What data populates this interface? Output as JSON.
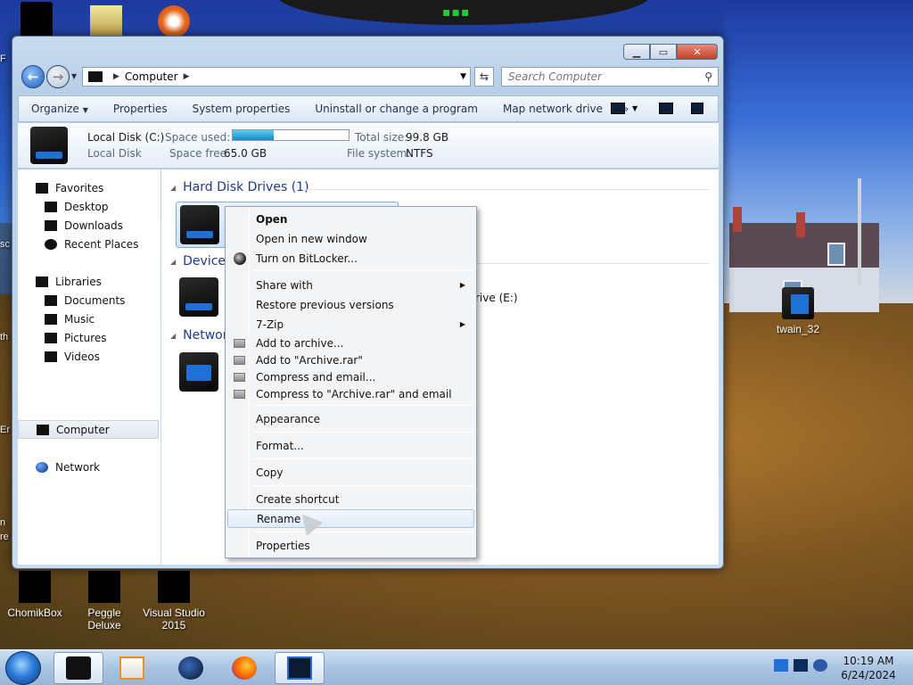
{
  "window": {
    "address": {
      "crumb": "Computer"
    },
    "search": {
      "placeholder": "Search Computer"
    },
    "toolbar": {
      "organize": "Organize",
      "properties": "Properties",
      "system_properties": "System properties",
      "uninstall": "Uninstall or change a program",
      "map_drive": "Map network drive",
      "more": "»"
    },
    "details": {
      "name": "Local Disk (C:)",
      "type": "Local Disk",
      "space_used_label": "Space used:",
      "space_used_fraction": 0.35,
      "space_free_label": "Space free:",
      "space_free_value": "65.0 GB",
      "total_size_label": "Total size:",
      "total_size_value": "99.8 GB",
      "file_system_label": "File system:",
      "file_system_value": "NTFS"
    },
    "nav": {
      "favorites": "Favorites",
      "desktop": "Desktop",
      "downloads": "Downloads",
      "recent": "Recent Places",
      "libraries": "Libraries",
      "documents": "Documents",
      "music": "Music",
      "pictures": "Pictures",
      "videos": "Videos",
      "computer": "Computer",
      "network": "Network"
    },
    "content": {
      "hard_disks": "Hard Disk Drives (1)",
      "devices": "Devices",
      "network": "Networ",
      "drive_e_partial": "rive (E:)"
    }
  },
  "context_menu": {
    "open": "Open",
    "open_new": "Open in new window",
    "bitlocker": "Turn on BitLocker...",
    "share_with": "Share with",
    "restore": "Restore previous versions",
    "zip": "7-Zip",
    "add_archive": "Add to archive...",
    "add_rar": "Add to \"Archive.rar\"",
    "compress_email": "Compress and email...",
    "compress_rar_email": "Compress to \"Archive.rar\" and email",
    "appearance": "Appearance",
    "format": "Format...",
    "copy": "Copy",
    "create_shortcut": "Create shortcut",
    "rename": "Rename",
    "properties": "Properties"
  },
  "desktop": {
    "icons": {
      "chomikbox": "ChomikBox",
      "peggle": "Peggle Deluxe",
      "vs": "Visual Studio 2015",
      "twain": "twain_32"
    },
    "edge_text": [
      "sc",
      "th",
      "Er",
      "n",
      "re",
      "F"
    ]
  },
  "taskbar": {
    "time": "10:19 AM",
    "date": "6/24/2024"
  },
  "colors": {
    "accent": "#1e3a8a",
    "usage_bar": "#1a8ac8",
    "start_orb": "#2a7bd8"
  }
}
